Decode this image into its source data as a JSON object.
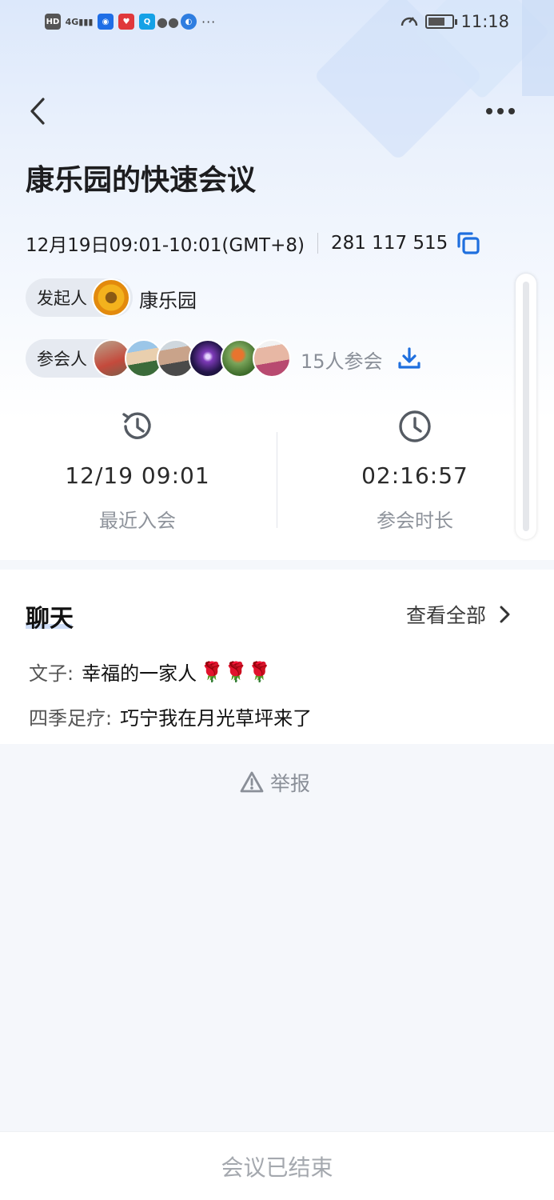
{
  "status_bar": {
    "time": "11:18",
    "network": "4G",
    "hd": "HD",
    "more": "···"
  },
  "meeting": {
    "title": "康乐园的快速会议",
    "time_range": "12月19日09:01-10:01(GMT+8)",
    "meeting_id": "281 117 515",
    "initiator_label": "发起人",
    "initiator_name": "康乐园",
    "participants_label": "参会人",
    "participants_count": "15人参会"
  },
  "stats": {
    "last_join_value": "12/19 09:01",
    "last_join_label": "最近入会",
    "duration_value": "02:16:57",
    "duration_label": "参会时长"
  },
  "chat": {
    "title": "聊天",
    "view_all": "查看全部",
    "messages": [
      {
        "sender": "文子:",
        "text": "幸福的一家人",
        "emoji": "🌹🌹🌹"
      },
      {
        "sender": "四季足疗:",
        "text": "巧宁我在月光草坪来了",
        "emoji": ""
      }
    ]
  },
  "report_label": "举报",
  "footer_status": "会议已结束",
  "colors": {
    "accent": "#1f6fde",
    "muted": "#8a8f98"
  }
}
